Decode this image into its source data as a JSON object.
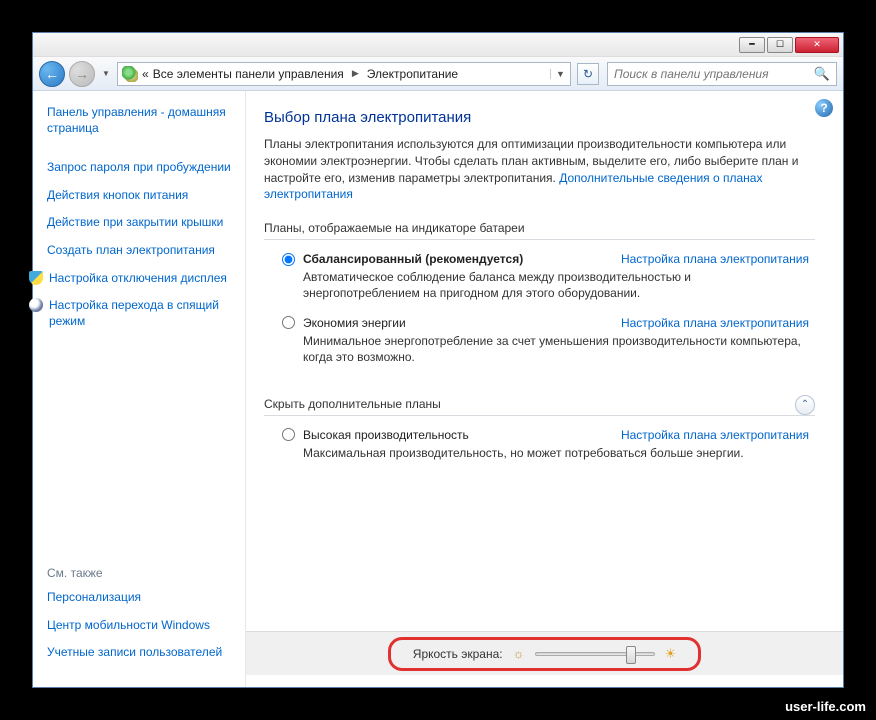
{
  "titlebar": {},
  "nav": {
    "breadcrumb_prefix": "«",
    "breadcrumb1": "Все элементы панели управления",
    "breadcrumb2": "Электропитание",
    "search_placeholder": "Поиск в панели управления"
  },
  "sidebar": {
    "home": "Панель управления - домашняя страница",
    "links": [
      "Запрос пароля при пробуждении",
      "Действия кнопок питания",
      "Действие при закрытии крышки",
      "Создать план электропитания"
    ],
    "shield_link": "Настройка отключения дисплея",
    "moon_link": "Настройка перехода в спящий режим",
    "seealso_label": "См. также",
    "seealso": [
      "Персонализация",
      "Центр мобильности Windows",
      "Учетные записи пользователей"
    ]
  },
  "main": {
    "title": "Выбор плана электропитания",
    "desc": "Планы электропитания используются для оптимизации производительности компьютера или экономии электроэнергии. Чтобы сделать план активным, выделите его, либо выберите план и настройте его, изменив параметры электропитания. ",
    "desc_link": "Дополнительные сведения о планах электропитания",
    "fieldset1_label": "Планы, отображаемые на индикаторе батареи",
    "fieldset2_label": "Скрыть дополнительные планы",
    "plans": {
      "balanced": {
        "name": "Сбалансированный (рекомендуется)",
        "config": "Настройка плана электропитания",
        "desc": "Автоматическое соблюдение баланса между производительностью и энергопотреблением на пригодном для этого оборудовании."
      },
      "saver": {
        "name": "Экономия энергии",
        "config": "Настройка плана электропитания",
        "desc": "Минимальное энергопотребление за счет уменьшения производительности компьютера, когда это возможно."
      },
      "high": {
        "name": "Высокая производительность",
        "config": "Настройка плана электропитания",
        "desc": "Максимальная производительность, но может потребоваться больше энергии."
      }
    },
    "brightness_label": "Яркость экрана:",
    "brightness_percent": 82
  },
  "watermark": "user-life.com"
}
